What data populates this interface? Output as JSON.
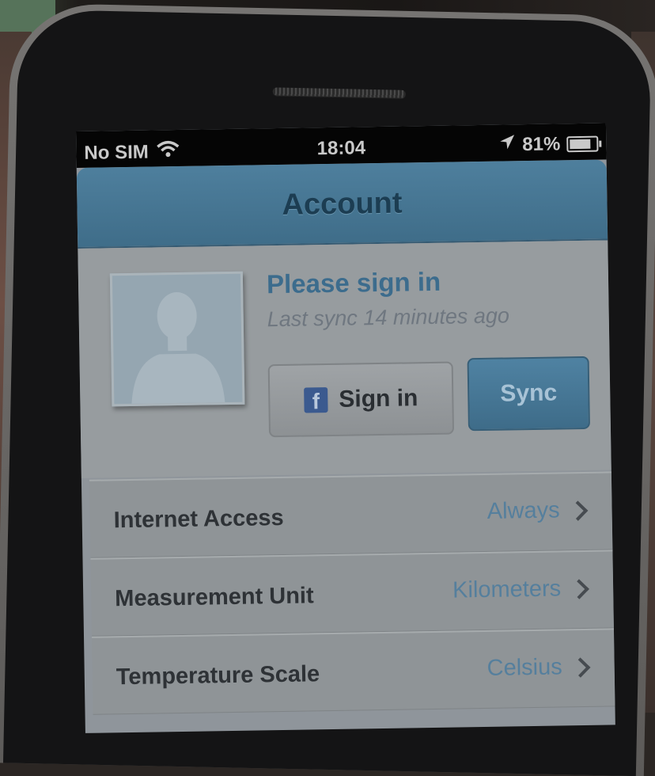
{
  "status_bar": {
    "carrier": "No SIM",
    "time": "18:04",
    "battery_percent_label": "81%",
    "battery_level": 0.81,
    "icons": [
      "wifi-icon",
      "location-arrow-icon",
      "battery-icon"
    ]
  },
  "nav": {
    "title": "Account"
  },
  "profile": {
    "title": "Please sign in",
    "subtitle": "Last sync 14 minutes ago",
    "avatar_icon": "avatar-placeholder-icon"
  },
  "buttons": {
    "signin_icon": "facebook-icon",
    "signin_icon_glyph": "f",
    "signin_label": "Sign in",
    "sync_label": "Sync"
  },
  "settings": [
    {
      "label": "Internet Access",
      "value": "Always"
    },
    {
      "label": "Measurement Unit",
      "value": "Kilometers"
    },
    {
      "label": "Temperature Scale",
      "value": "Celsius"
    }
  ],
  "colors": {
    "navbar": "#4e7f9d",
    "accent_text": "#3c6c8d",
    "sync_button": "#4f82a2",
    "facebook": "#3b5a8f"
  }
}
